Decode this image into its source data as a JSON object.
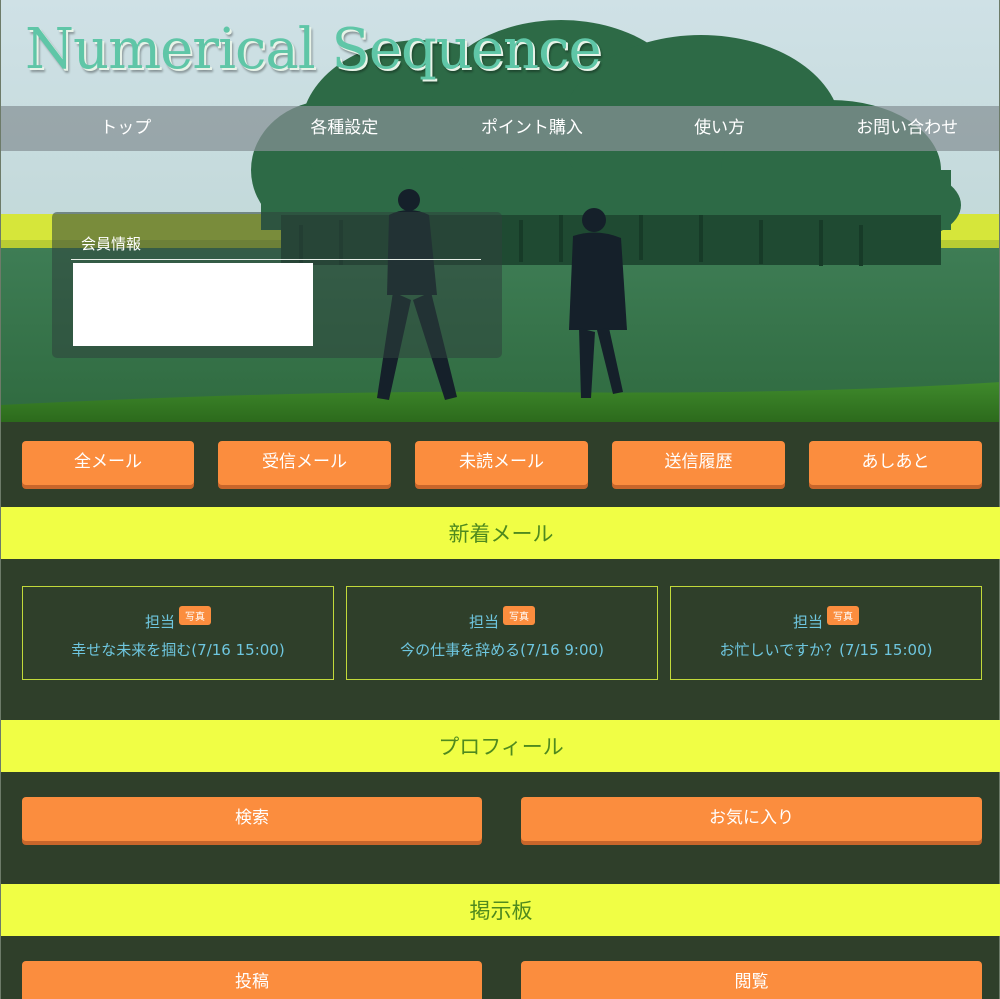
{
  "header": {
    "site_title": "Numerical Sequence"
  },
  "nav": {
    "items": [
      "トップ",
      "各種設定",
      "ポイント購入",
      "使い方",
      "お問い合わせ"
    ]
  },
  "member": {
    "title": "会員情報"
  },
  "mail_buttons": [
    "全メール",
    "受信メール",
    "未読メール",
    "送信履歴",
    "あしあと"
  ],
  "sections": {
    "new_mail": "新着メール",
    "profile": "プロフィール",
    "board": "掲示板"
  },
  "new_mails": [
    {
      "from": "担当",
      "badge": "写真",
      "subject": "幸せな未来を掴む(7/16 15:00)"
    },
    {
      "from": "担当",
      "badge": "写真",
      "subject": "今の仕事を辞める(7/16 9:00)"
    },
    {
      "from": "担当",
      "badge": "写真",
      "subject": "お忙しいですか？(7/15 15:00)"
    }
  ],
  "profile_buttons": [
    "検索",
    "お気に入り"
  ],
  "board_buttons": [
    "投稿",
    "閲覧"
  ],
  "colors": {
    "background": "#2f3f2a",
    "band": "#f0fe45",
    "band_text": "#4f8a1e",
    "button": "#fb8d3e",
    "mail_text": "#6ec6df",
    "title": "#5fc6a7"
  }
}
